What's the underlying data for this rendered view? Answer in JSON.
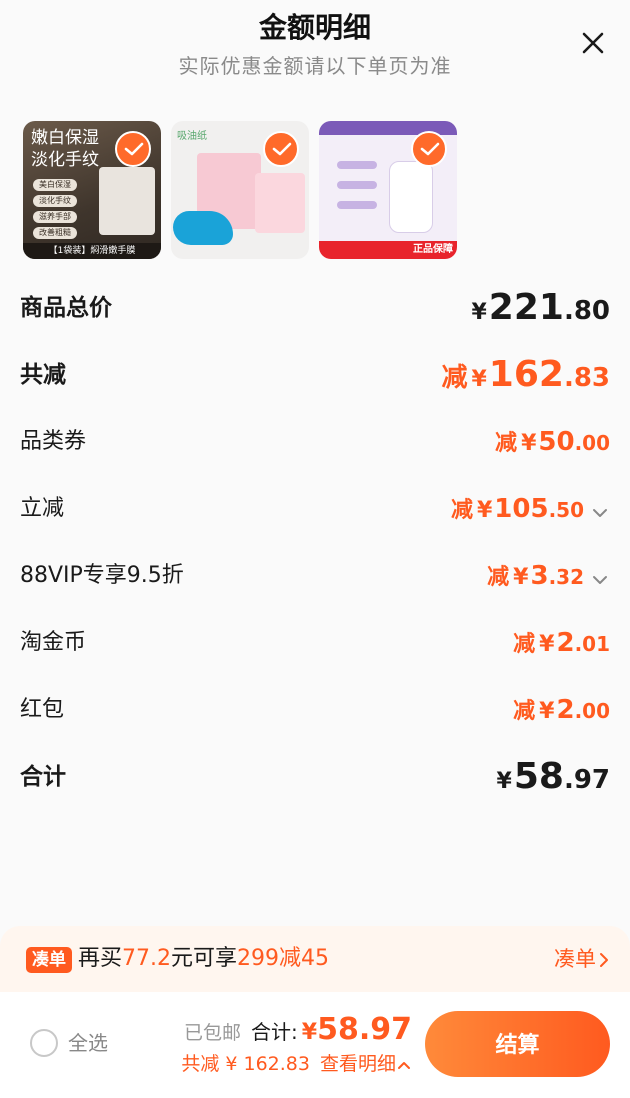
{
  "header": {
    "title": "金额明细",
    "subtitle": "实际优惠金额请以下单页为准"
  },
  "products": [
    {
      "title_line1": "嫩白保湿",
      "title_line2": "淡化手纹",
      "lines": [
        "美白保湿",
        "淡化手纹",
        "滋养手部",
        "改善粗糙"
      ],
      "banner": "【1袋装】焖滑嫩手膜",
      "selected": true
    },
    {
      "header": "吸油纸",
      "selected": true
    },
    {
      "banner": "正品保障",
      "selected": true
    }
  ],
  "details": {
    "total": {
      "label": "商品总价",
      "currency": "¥",
      "int": "221",
      "dec": ".80"
    },
    "reduce": {
      "label": "共减",
      "prefix": "减",
      "currency": "¥",
      "int": "162",
      "dec": ".83"
    },
    "coupon": {
      "label": "品类券",
      "prefix": "减",
      "currency": "¥",
      "int": "50",
      "dec": ".00"
    },
    "instant": {
      "label": "立减",
      "prefix": "减",
      "currency": "¥",
      "int": "105",
      "dec": ".50"
    },
    "vip": {
      "label": "88VIP专享9.5折",
      "prefix": "减",
      "currency": "¥",
      "int": "3",
      "dec": ".32"
    },
    "coins": {
      "label": "淘金币",
      "prefix": "减",
      "currency": "¥",
      "int": "2",
      "dec": ".01"
    },
    "redpacket": {
      "label": "红包",
      "prefix": "减",
      "currency": "¥",
      "int": "2",
      "dec": ".00"
    },
    "subtotal": {
      "label": "合计",
      "currency": "¥",
      "int": "58",
      "dec": ".97"
    }
  },
  "promo": {
    "tag": "凑单",
    "text_a": "再买",
    "amount": "77.2",
    "text_b": "元可享",
    "deal": "299减45",
    "link": "凑单"
  },
  "footer": {
    "select_all": "全选",
    "shipping": "已包邮",
    "total_label": "合计:",
    "currency": "¥",
    "total_amount": "58.97",
    "discount_text": "共减 ¥ 162.83",
    "view_detail": "查看明细",
    "checkout": "结算"
  },
  "colors": {
    "accent": "#ff5a1f",
    "accent_light": "#ff8a3a",
    "promo_bg": "#fff6ef"
  }
}
